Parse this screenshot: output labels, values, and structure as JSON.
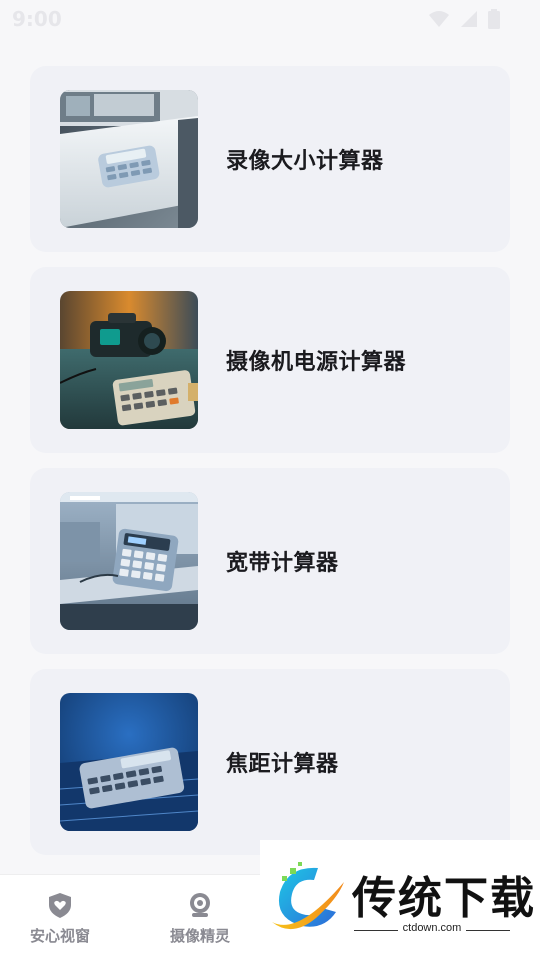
{
  "status_bar": {
    "time": "9:00",
    "icons": [
      "wifi-icon",
      "signal-icon",
      "battery-icon"
    ]
  },
  "cards": [
    {
      "title": "录像大小计算器",
      "image": "desk-calculator-photo"
    },
    {
      "title": "摄像机电源计算器",
      "image": "camera-calculator-photo"
    },
    {
      "title": "宽带计算器",
      "image": "office-calculator-photo"
    },
    {
      "title": "焦距计算器",
      "image": "blue-calculator-photo"
    }
  ],
  "bottom_nav": {
    "items": [
      {
        "label": "安心视窗",
        "icon": "shield-heart-icon"
      },
      {
        "label": "摄像精灵",
        "icon": "webcam-icon"
      }
    ]
  },
  "watermark": {
    "text": "传统下载",
    "url": "ctdown.com"
  },
  "colors": {
    "card_bg": "#f0f1f6",
    "page_bg": "#f7f7f9",
    "nav_label": "#8a8a92"
  }
}
